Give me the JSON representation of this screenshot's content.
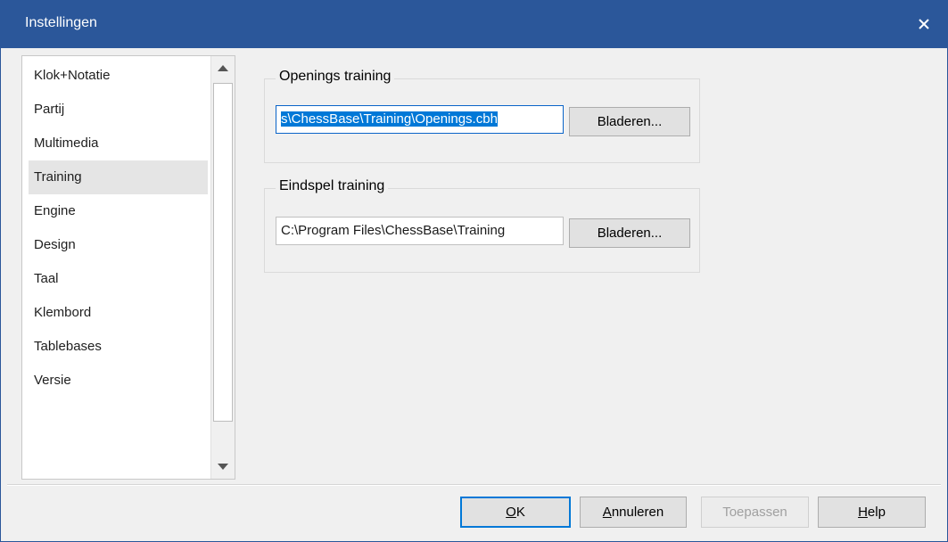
{
  "window": {
    "title": "Instellingen",
    "close_glyph": "✕"
  },
  "sidebar": {
    "items": [
      {
        "label": "Klok+Notatie"
      },
      {
        "label": "Partij"
      },
      {
        "label": "Multimedia"
      },
      {
        "label": "Training",
        "selected": true
      },
      {
        "label": "Engine"
      },
      {
        "label": "Design"
      },
      {
        "label": "Taal"
      },
      {
        "label": "Klembord"
      },
      {
        "label": "Tablebases"
      },
      {
        "label": "Versie"
      }
    ],
    "scroll_up_glyph": "▲",
    "scroll_down_glyph": "▼"
  },
  "openings": {
    "legend": "Openings training",
    "path": "s\\ChessBase\\Training\\Openings.cbh",
    "browse_label": "Bladeren..."
  },
  "endgame": {
    "legend": "Eindspel training",
    "path": "C:\\Program Files\\ChessBase\\Training",
    "browse_label": "Bladeren..."
  },
  "buttons": {
    "ok": {
      "mnemonic": "O",
      "rest": "K"
    },
    "cancel": {
      "mnemonic": "A",
      "rest": "nnuleren"
    },
    "apply": {
      "label": "Toepassen"
    },
    "help": {
      "mnemonic": "H",
      "rest": "elp"
    }
  },
  "colors": {
    "title_bar": "#2b579a",
    "selection": "#0078d7"
  }
}
